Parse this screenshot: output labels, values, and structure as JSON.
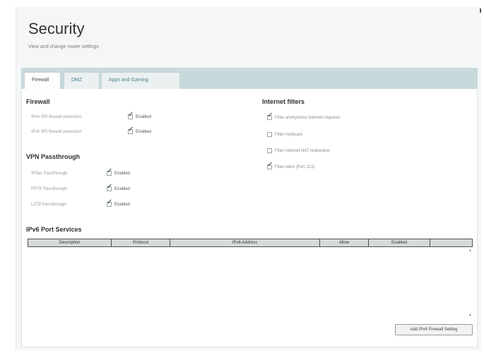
{
  "header": {
    "title": "Security",
    "subtitle": "View and change router settings"
  },
  "tabs": [
    {
      "label": "Firewall",
      "active": true
    },
    {
      "label": "DMZ",
      "active": false
    },
    {
      "label": "Apps and Gaming",
      "active": false
    }
  ],
  "firewall": {
    "title": "Firewall",
    "items": [
      {
        "label": "IPv4 SPI firewall protection",
        "checkbox_text": "Enabled",
        "checked": true
      },
      {
        "label": "IPv6 SPI firewall protection",
        "checkbox_text": "Enabled",
        "checked": true
      }
    ]
  },
  "vpn": {
    "title": "VPN Passthrough",
    "items": [
      {
        "label": "IPSec Passthrough",
        "checkbox_text": "Enabled",
        "checked": true
      },
      {
        "label": "PPTP Passthrough",
        "checkbox_text": "Enabled",
        "checked": true
      },
      {
        "label": "L2TP Passthrough",
        "checkbox_text": "Enabled",
        "checked": true
      }
    ]
  },
  "internet_filters": {
    "title": "Internet filters",
    "items": [
      {
        "label": "Filter anonymous Internet requests",
        "checked": true
      },
      {
        "label": "Filter multicast",
        "checked": false
      },
      {
        "label": "Filter Internet NAT redirection",
        "checked": false
      },
      {
        "label": "Filter ident (Port 113)",
        "checked": true
      }
    ]
  },
  "ipv6": {
    "title": "IPv6 Port Services",
    "columns": [
      "Description",
      "Protocol",
      "IPv6 Address",
      "Allow",
      "Enabled"
    ],
    "add_button": "Add IPv6 Firewall Setting"
  },
  "colors": {
    "tabbar": "#c8d9dc",
    "inactive_tab_text": "#4a7f8c"
  }
}
